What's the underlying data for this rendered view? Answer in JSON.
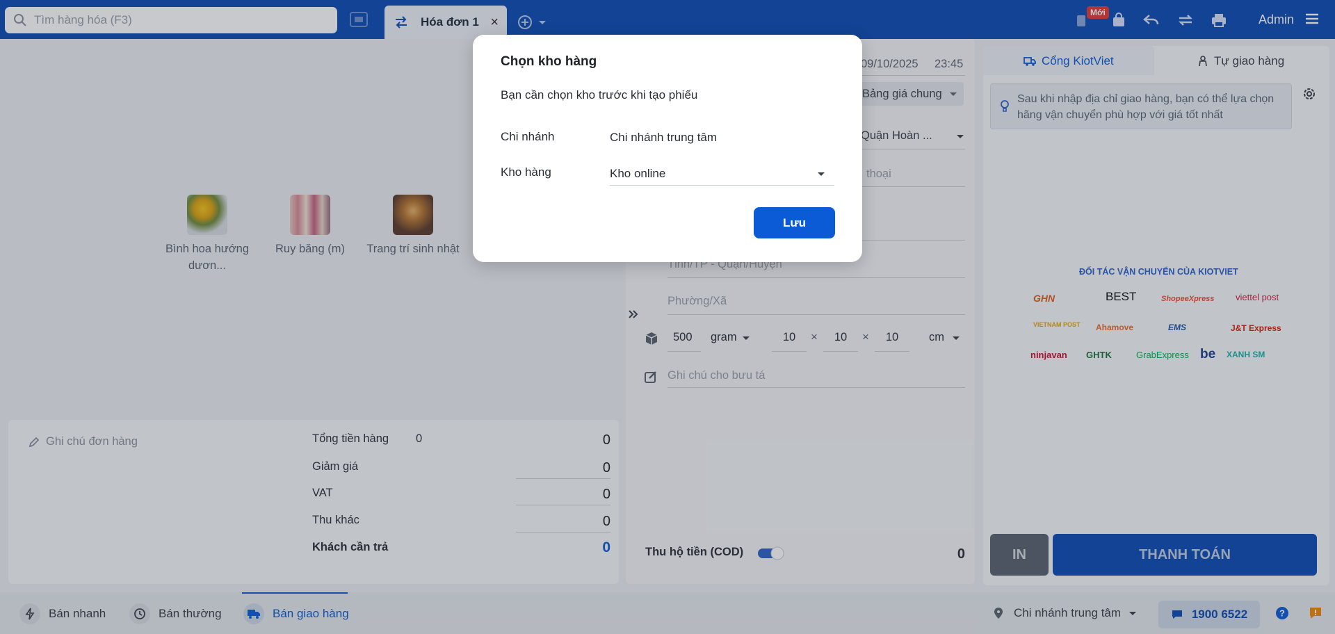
{
  "topbar": {
    "search_placeholder": "Tìm hàng hóa (F3)",
    "invoice_tab": "Hóa đơn 1",
    "new_badge": "Mới",
    "user": "Admin"
  },
  "products": [
    {
      "name": "Bình hoa hướng dươn..."
    },
    {
      "name": "Ruy băng (m)"
    },
    {
      "name": "Trang trí sinh nhật"
    }
  ],
  "summary": {
    "note_placeholder": "Ghi chú đơn hàng",
    "total_label": "Tổng tiền hàng",
    "total_count": "0",
    "total_value": "0",
    "discount_label": "Giảm giá",
    "discount_value": "0",
    "vat_label": "VAT",
    "vat_value": "0",
    "other_label": "Thu khác",
    "other_value": "0",
    "due_label": "Khách cần trả",
    "due_value": "0"
  },
  "delivery": {
    "date": "09/10/2025",
    "time": "23:45",
    "price_list": "Bảng giá chung",
    "district": "Quận Hoàn ...",
    "phone_placeholder": "thoại",
    "city_placeholder": "Tỉnh/TP - Quận/Huyện",
    "ward_placeholder": "Phường/Xã",
    "weight": "500",
    "weight_unit": "gram",
    "length": "10",
    "width": "10",
    "height": "10",
    "dim_unit": "cm",
    "dim_sep": "×",
    "courier_note_placeholder": "Ghi chú cho bưu tá",
    "cod_label": "Thu hộ tiền (COD)",
    "cod_value": "0"
  },
  "shipping": {
    "tab_kiotviet": "Cổng KiotViet",
    "tab_self": "Tự giao hàng",
    "info": "Sau khi nhập địa chỉ giao hàng, bạn có thể lựa chọn hãng vận chuyển phù hợp với giá tốt nhất",
    "partners_title": "ĐỐI TÁC VẬN CHUYỂN CỦA KIOTVIET",
    "partners": [
      "GHN",
      "BEST",
      "ShopeeXpress",
      "viettel post",
      "VIETNAM POST",
      "Ahamove",
      "EMS",
      "J&T Express",
      "ninjavan",
      "GHTK",
      "GrabExpress",
      "be",
      "XANH SM"
    ],
    "print_btn": "IN",
    "pay_btn": "THANH TOÁN"
  },
  "bottom": {
    "quick_sale": "Bán nhanh",
    "normal_sale": "Bán thường",
    "delivery_sale": "Bán giao hàng",
    "branch": "Chi nhánh trung tâm",
    "hotline": "1900 6522"
  },
  "modal": {
    "title": "Chọn kho hàng",
    "description": "Bạn cần chọn kho trước khi tạo phiếu",
    "branch_label": "Chi nhánh",
    "branch_value": "Chi nhánh trung tâm",
    "warehouse_label": "Kho hàng",
    "warehouse_value": "Kho online",
    "save_btn": "Lưu"
  },
  "colors": {
    "brand_blue": "#0b4bb3",
    "primary_button": "#0b5bd6"
  }
}
